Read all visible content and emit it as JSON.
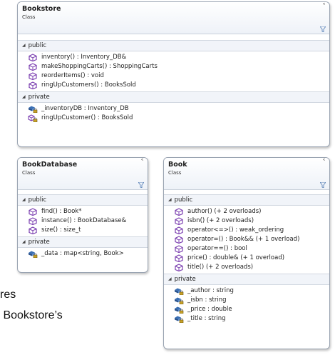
{
  "bookstore": {
    "name": "Bookstore",
    "stereotype": "Class",
    "public_label": "public",
    "public": [
      "inventory() : Inventory_DB&",
      "makeShoppingCarts() : ShoppingCarts",
      "reorderItems() : void",
      "ringUpCustomers() : BooksSold"
    ],
    "private_label": "private",
    "private_fields": [
      "_inventoryDB : Inventory_DB"
    ],
    "private_methods": [
      "ringUpCustomer() : BooksSold"
    ]
  },
  "bookdatabase": {
    "name": "BookDatabase",
    "stereotype": "Class",
    "public_label": "public",
    "public": [
      "find() : Book*",
      "instance() : BookDatabase&",
      "size() : size_t"
    ],
    "private_label": "private",
    "private_fields": [
      "_data : map<string, Book>"
    ]
  },
  "book": {
    "name": "Book",
    "stereotype": "Class",
    "public_label": "public",
    "public": [
      "author() (+ 2 overloads)",
      "isbn() (+ 2 overloads)",
      "operator<=>() : weak_ordering",
      "operator=() : Book&& (+ 1 overload)",
      "operator==() : bool",
      "price() : double& (+ 1 overload)",
      "title() (+ 2 overloads)"
    ],
    "private_label": "private",
    "private_fields": [
      "_author : string",
      "_isbn : string",
      "_price : double",
      "_title : string"
    ]
  },
  "background_text": [
    "res",
    "Bookstore’s"
  ],
  "icons": {
    "collapse": "double-chevron-up-icon",
    "filter": "funnel-icon",
    "section_toggle": "triangle-down-icon",
    "method": "method-cube-icon",
    "private_method": "private-method-lock-icon",
    "private_field": "private-field-lock-icon"
  },
  "colors": {
    "method": "#7b3fb0",
    "field": "#3a6fb4",
    "header_bg": "#eef2f8",
    "section_bg": "#f1f4f9"
  }
}
